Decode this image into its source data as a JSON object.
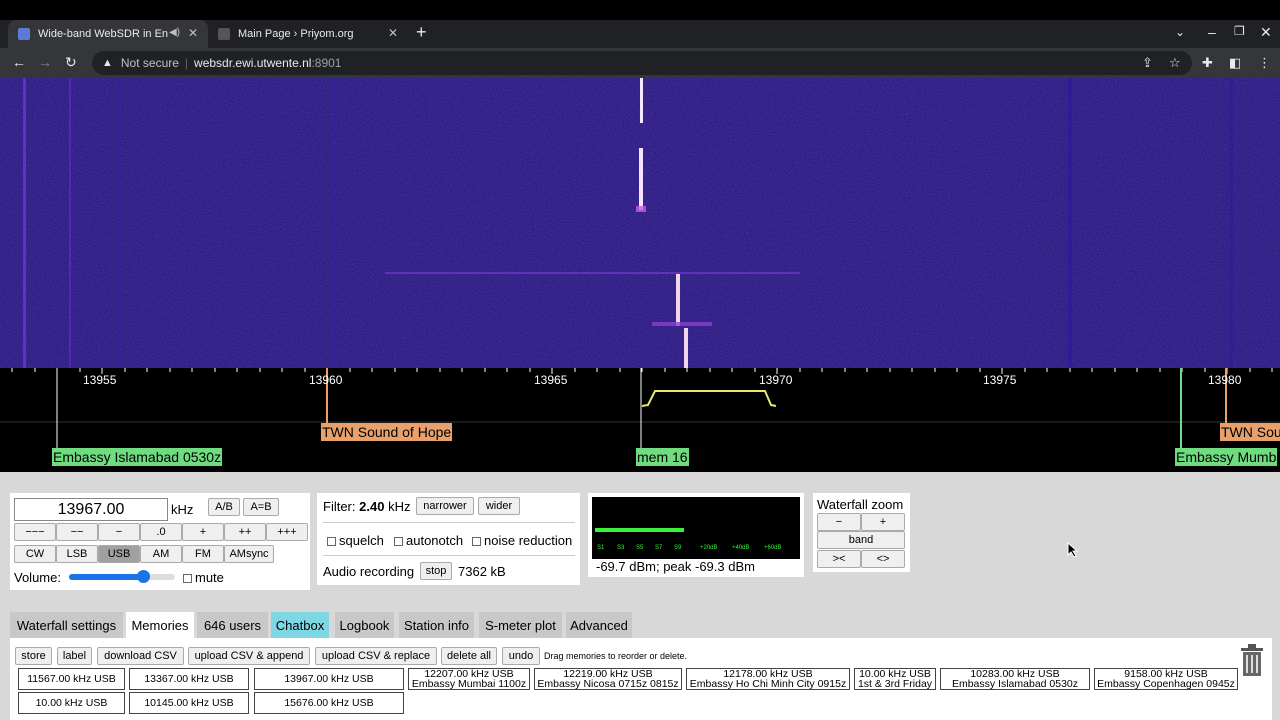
{
  "browser": {
    "tabs": [
      {
        "title": "Wide-band WebSDR in Ensch",
        "active": true
      },
      {
        "title": "Main Page › Priyom.org",
        "active": false
      }
    ],
    "new_tab": "+",
    "omnibox": {
      "security": "Not secure",
      "host": "websdr.ewi.utwente.nl",
      "port": ":8901"
    }
  },
  "scale": {
    "ticks": [
      "13955",
      "13960",
      "13965",
      "13970",
      "13975",
      "13980"
    ],
    "labels_top": [
      "TWN Sound of Hope",
      "TWN Sou"
    ],
    "labels_bottom": [
      "Embassy Islamabad 0530z",
      "mem 16",
      "Embassy Mumb"
    ]
  },
  "tuning": {
    "frequency": "13967.00",
    "unit": "kHz",
    "ab": "A/B",
    "aeqb": "A=B",
    "steps": [
      "−−−",
      "−−",
      "−",
      ".0",
      "+",
      "++",
      "+++"
    ],
    "modes": [
      "CW",
      "LSB",
      "USB",
      "AM",
      "FM",
      "AMsync"
    ],
    "active_mode": "USB",
    "volume_label": "Volume:",
    "volume_level": 0.7,
    "mute_label": "mute"
  },
  "filter": {
    "label": "Filter:",
    "value": "2.40",
    "unit": "kHz",
    "narrower": "narrower",
    "wider": "wider",
    "squelch": "squelch",
    "autonotch": "autonotch",
    "noise_reduction": "noise reduction",
    "audio_recording": "Audio recording",
    "stop": "stop",
    "rec_size": "7362 kB"
  },
  "smeter": {
    "scale": [
      "S1",
      "S3",
      "S5",
      "S7",
      "S9",
      "+20dB",
      "+40dB",
      "+60dB"
    ],
    "reading": "-69.7 dBm; peak  -69.3 dBm",
    "level": 0.44
  },
  "zoom": {
    "title": "Waterfall zoom",
    "minus": "−",
    "plus": "+",
    "band": "band",
    "narrow": "><",
    "wide": "<>"
  },
  "panel_tabs": [
    "Waterfall settings",
    "Memories",
    "646 users",
    "Chatbox",
    "Logbook",
    "Station info",
    "S-meter plot",
    "Advanced"
  ],
  "memories": {
    "buttons": [
      "store",
      "label",
      "download CSV",
      "upload CSV & append",
      "upload CSV & replace",
      "delete all",
      "undo"
    ],
    "hint": "Drag memories to reorder or delete.",
    "row1": [
      [
        "11567.00 kHz USB",
        ""
      ],
      [
        "13367.00 kHz USB",
        ""
      ],
      [
        "13967.00 kHz USB",
        ""
      ],
      [
        "12207.00 kHz USB",
        "Embassy Mumbai 1100z"
      ],
      [
        "12219.00 kHz USB",
        "Embassy Nicosa 0715z 0815z"
      ],
      [
        "12178.00 kHz USB",
        "Embassy Ho Chi Minh City 0915z"
      ],
      [
        "10.00 kHz USB",
        "1st & 3rd Friday"
      ],
      [
        "10283.00 kHz USB",
        "Embassy Islamabad 0530z"
      ],
      [
        "9158.00 kHz USB",
        "Embassy Copenhagen 0945z"
      ]
    ],
    "row2": [
      "10.00 kHz USB",
      "10145.00 kHz USB",
      "15676.00 kHz USB"
    ]
  }
}
